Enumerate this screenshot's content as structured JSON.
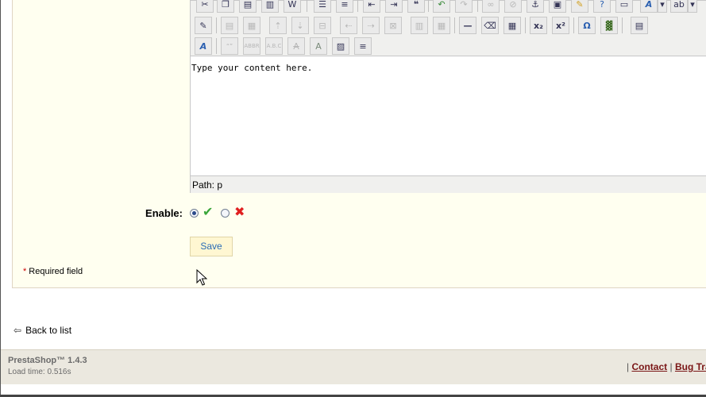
{
  "editor": {
    "toolbar_row1": [
      "scissors-icon",
      "copy-icon",
      "paste-icon",
      "paste-text-icon",
      "paste-word-icon",
      "bullet-list-icon",
      "numbered-list-icon",
      "outdent-icon",
      "indent-icon",
      "blockquote-icon",
      "undo-icon",
      "redo-icon",
      "link-icon",
      "unlink-icon",
      "anchor-icon",
      "image-icon",
      "cleanup-icon",
      "help-icon",
      "code-icon",
      "text-color-icon",
      "highlight-color-icon"
    ],
    "toolbar_row2": [
      "edit-css-icon",
      "table-row-props-icon",
      "table-cell-props-icon",
      "insert-row-before-icon",
      "insert-row-after-icon",
      "delete-row-icon",
      "insert-col-before-icon",
      "insert-col-after-icon",
      "delete-col-icon",
      "split-cells-icon",
      "merge-cells-icon",
      "horizontal-rule-icon",
      "remove-format-icon",
      "visual-aid-icon",
      "subscript-icon",
      "superscript-icon",
      "special-char-icon",
      "media-icon",
      "template-icon"
    ],
    "toolbar_row3": [
      "styles-icon",
      "cite-icon",
      "abbr-icon",
      "acronym-icon",
      "delete-text-icon",
      "insert-text-icon",
      "attributes-icon",
      "non-breaking-icon"
    ],
    "content_text": "Type your content here.",
    "path_label": "Path: p"
  },
  "form": {
    "enable_label": "Enable:",
    "enable_yes_glyph": "✔",
    "enable_no_glyph": "✖",
    "enabled": true,
    "save_label": "Save",
    "required_star": "*",
    "required_note": "Required field"
  },
  "back_link": {
    "label": "Back to list",
    "arrow": "⇦"
  },
  "footer": {
    "brand": "PrestaShop™ 1.4.3",
    "load_time": "Load time: 0.516s",
    "separator": "|",
    "contact": "Contact",
    "bug_tracker": "Bug Trac"
  },
  "colors": {
    "panel_bg": "#fffff0",
    "link_red": "#7a1616",
    "check_green": "#3aa63a",
    "cross_red": "#e02020",
    "save_text": "#2a6cb6"
  }
}
